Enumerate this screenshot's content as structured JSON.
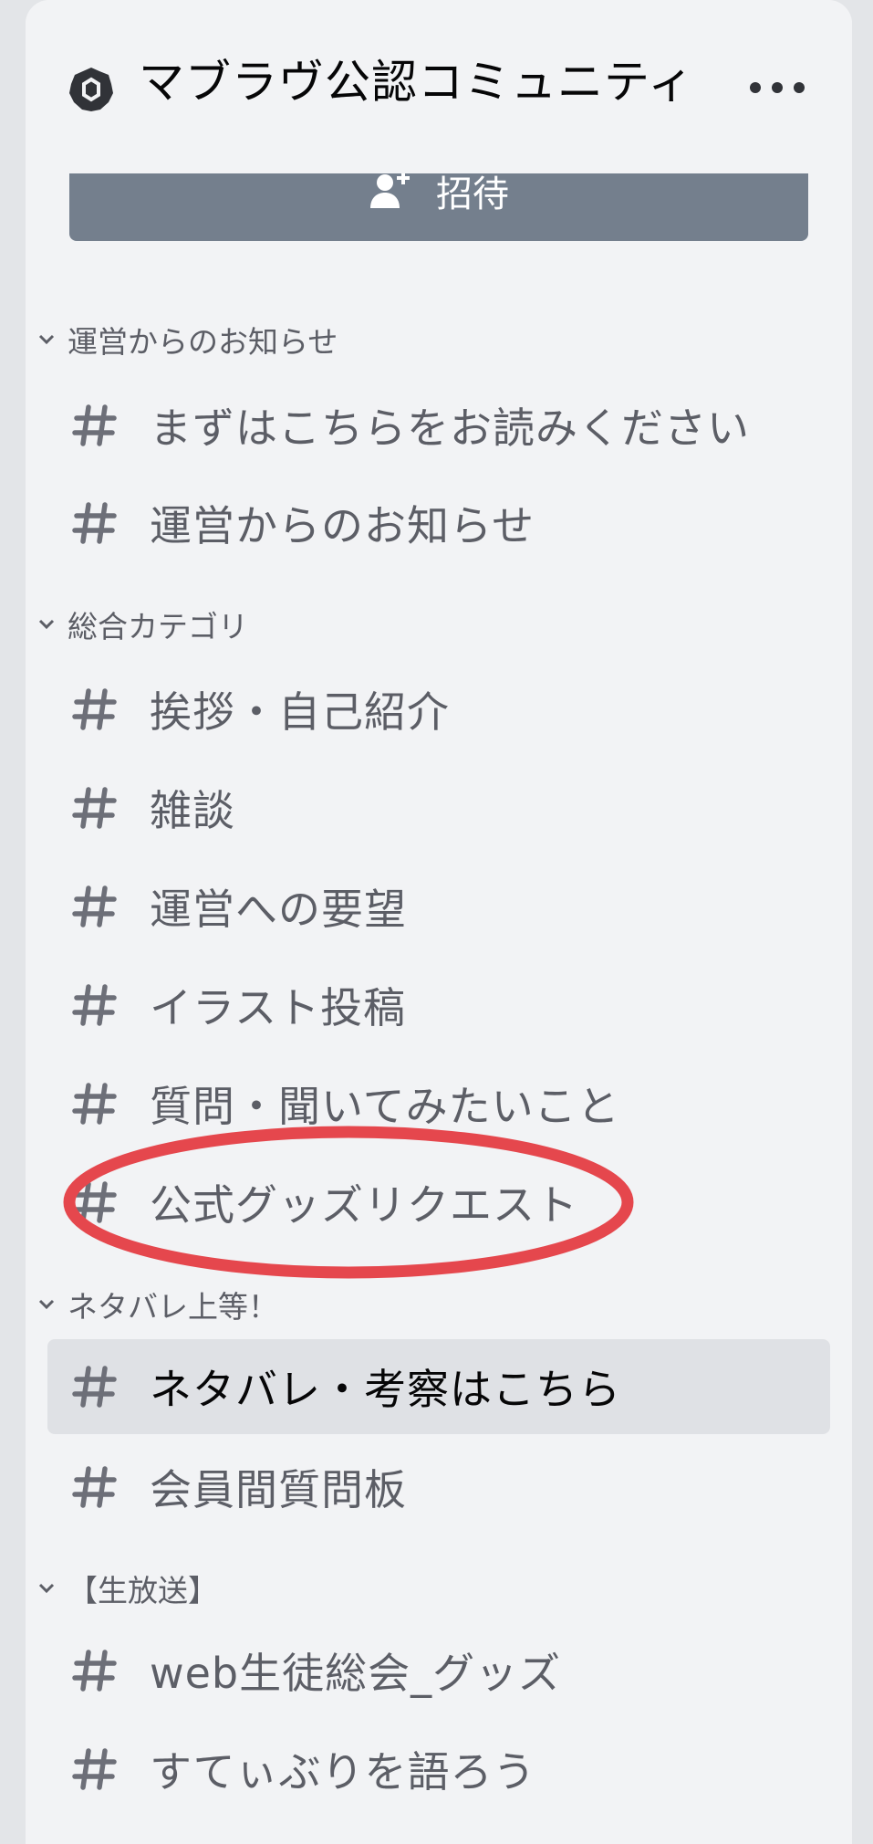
{
  "server": {
    "name": "マブラヴ公認コミュニティ",
    "icon": "server-icon"
  },
  "invite": {
    "label": "招待",
    "icon": "add-user-icon"
  },
  "categories": [
    {
      "name": "運営からのお知らせ",
      "channels": [
        {
          "name": "まずはこちらをお読みください"
        },
        {
          "name": "運営からのお知らせ"
        }
      ]
    },
    {
      "name": "総合カテゴリ",
      "channels": [
        {
          "name": "挨拶・自己紹介"
        },
        {
          "name": "雑談"
        },
        {
          "name": "運営への要望"
        },
        {
          "name": "イラスト投稿"
        },
        {
          "name": "質問・聞いてみたいこと"
        },
        {
          "name": "公式グッズリクエスト",
          "highlighted": true
        }
      ]
    },
    {
      "name": "ネタバレ上等！",
      "channels": [
        {
          "name": "ネタバレ・考察はこちら",
          "selected": true
        },
        {
          "name": "会員間質問板"
        }
      ]
    },
    {
      "name": "【生放送】",
      "channels": [
        {
          "name": "web生徒総会_グッズ"
        },
        {
          "name": "すてぃぶりを語ろう"
        }
      ]
    }
  ],
  "colors": {
    "annotation": "#e5474d",
    "selected_bg": "#dfe1e5",
    "invite_bg": "#747f8d"
  }
}
